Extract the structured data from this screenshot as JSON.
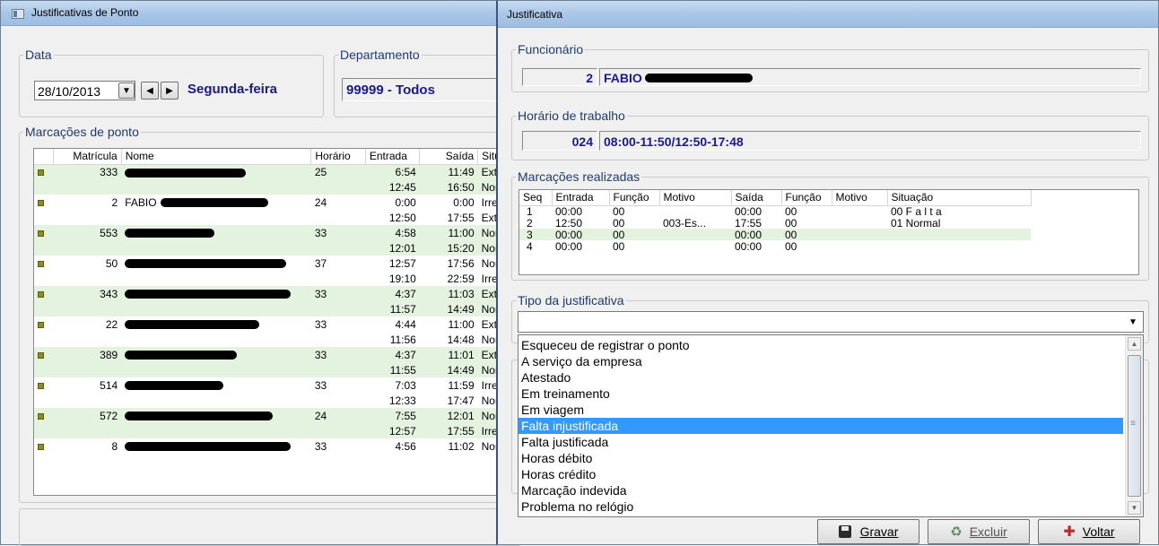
{
  "main_window": {
    "title": "Justificativas de Ponto",
    "data_group": "Data",
    "date_value": "28/10/2013",
    "weekday": "Segunda-feira",
    "dept_group": "Departamento",
    "dept_value": "99999 - Todos",
    "marcacoes_group": "Marcações de ponto",
    "columns": [
      "Matrícula",
      "Nome",
      "Horário",
      "Entrada",
      "Saída",
      "Situaçã"
    ],
    "rows": [
      {
        "mat": "333",
        "hor": "25",
        "ent": "6:54",
        "sai": "11:49",
        "sit": "Extra",
        "green": true,
        "flag": true
      },
      {
        "mat": "",
        "hor": "",
        "ent": "12:45",
        "sai": "16:50",
        "sit": "Normal",
        "green": true,
        "flag": false
      },
      {
        "mat": "2",
        "nome": "FABIO",
        "hor": "24",
        "ent": "0:00",
        "sai": "0:00",
        "sit": "Irregula",
        "green": false,
        "flag": true
      },
      {
        "mat": "",
        "hor": "",
        "ent": "12:50",
        "sai": "17:55",
        "sit": "Extra",
        "green": false,
        "flag": false
      },
      {
        "mat": "553",
        "hor": "33",
        "ent": "4:58",
        "sai": "11:00",
        "sit": "Normal",
        "green": true,
        "flag": true
      },
      {
        "mat": "",
        "hor": "",
        "ent": "12:01",
        "sai": "15:20",
        "sit": "Normal",
        "green": true,
        "flag": false
      },
      {
        "mat": "50",
        "hor": "37",
        "ent": "12:57",
        "sai": "17:56",
        "sit": "Normal",
        "green": false,
        "flag": true
      },
      {
        "mat": "",
        "hor": "",
        "ent": "19:10",
        "sai": "22:59",
        "sit": "Irregula",
        "green": false,
        "flag": false
      },
      {
        "mat": "343",
        "hor": "33",
        "ent": "4:37",
        "sai": "11:03",
        "sit": "Extra",
        "green": true,
        "flag": true
      },
      {
        "mat": "",
        "hor": "",
        "ent": "11:57",
        "sai": "14:49",
        "sit": "Normal",
        "green": true,
        "flag": false
      },
      {
        "mat": "22",
        "hor": "33",
        "ent": "4:44",
        "sai": "11:00",
        "sit": "Extra",
        "green": false,
        "flag": true
      },
      {
        "mat": "",
        "hor": "",
        "ent": "11:56",
        "sai": "14:48",
        "sit": "Normal",
        "green": false,
        "flag": false
      },
      {
        "mat": "389",
        "hor": "33",
        "ent": "4:37",
        "sai": "11:01",
        "sit": "Extra",
        "green": true,
        "flag": true
      },
      {
        "mat": "",
        "hor": "",
        "ent": "11:55",
        "sai": "14:49",
        "sit": "Normal",
        "green": true,
        "flag": false
      },
      {
        "mat": "514",
        "hor": "33",
        "ent": "7:03",
        "sai": "11:59",
        "sit": "Irregula",
        "green": false,
        "flag": true
      },
      {
        "mat": "",
        "hor": "",
        "ent": "12:33",
        "sai": "17:47",
        "sit": "Normal",
        "green": false,
        "flag": false
      },
      {
        "mat": "572",
        "hor": "24",
        "ent": "7:55",
        "sai": "12:01",
        "sit": "Normal",
        "green": true,
        "flag": true
      },
      {
        "mat": "",
        "hor": "",
        "ent": "12:57",
        "sai": "17:55",
        "sit": "Irregula",
        "green": true,
        "flag": false
      },
      {
        "mat": "8",
        "hor": "33",
        "ent": "4:56",
        "sai": "11:02",
        "sit": "Normal",
        "green": false,
        "flag": true
      }
    ]
  },
  "dialog": {
    "title": "Justificativa",
    "funcionario_group": "Funcionário",
    "func_num": "2",
    "func_name": "FABIO",
    "horario_group": "Horário de trabalho",
    "horario_code": "024",
    "horario_value": "08:00-11:50/12:50-17:48",
    "marcacoes_group": "Marcações realizadas",
    "columns": [
      "Seq",
      "Entrada",
      "Função",
      "Motivo",
      "Saída",
      "Função",
      "Motivo",
      "Situação"
    ],
    "rows": [
      {
        "seq": "1",
        "ent": "00:00",
        "f1": "00",
        "m1": "",
        "sai": "00:00",
        "f2": "00",
        "m2": "",
        "sit": "00 F a l t a",
        "green": false
      },
      {
        "seq": "2",
        "ent": "12:50",
        "f1": "00",
        "m1": "003-Es...",
        "sai": "17:55",
        "f2": "00",
        "m2": "",
        "sit": "01 Normal",
        "green": false
      },
      {
        "seq": "3",
        "ent": "00:00",
        "f1": "00",
        "m1": "",
        "sai": "00:00",
        "f2": "00",
        "m2": "",
        "sit": "",
        "green": true
      },
      {
        "seq": "4",
        "ent": "00:00",
        "f1": "00",
        "m1": "",
        "sai": "00:00",
        "f2": "00",
        "m2": "",
        "sit": "",
        "green": false
      }
    ],
    "tipo_group": "Tipo da justificativa",
    "tipo_value": "",
    "options": [
      "Esqueceu de registrar o ponto",
      "A serviço da empresa",
      "Atestado",
      "Em treinamento",
      "Em viagem",
      "Falta injustificada",
      "Falta justificada",
      "Horas débito",
      "Horas crédito",
      "Marcação indevida",
      "Problema no relógio"
    ],
    "selected_option": "Falta injustificada",
    "gravar": "Gravar",
    "excluir": "Excluir",
    "voltar": "Voltar"
  },
  "colors": {
    "accent_navy": "#1a1a8c",
    "row_green": "#e3f3df",
    "selection": "#3399ff"
  }
}
